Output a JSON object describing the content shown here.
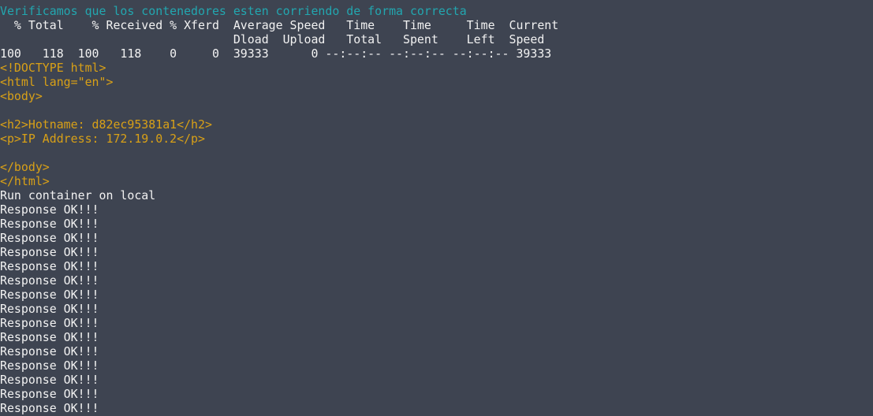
{
  "colors": {
    "background": "#3e4451",
    "cyan": "#22a7b0",
    "white": "#f2f2f2",
    "yellow": "#d8a017"
  },
  "terminal": {
    "lines": [
      {
        "text": "                ",
        "color": "white"
      },
      {
        "text": "Verificamos que los contenedores esten corriendo de forma correcta",
        "color": "cyan"
      },
      {
        "text": "  % Total    % Received % Xferd  Average Speed   Time    Time     Time  Current",
        "color": "white"
      },
      {
        "text": "                                 Dload  Upload   Total   Spent    Left  Speed",
        "color": "white"
      },
      {
        "text": "100   118  100   118    0     0  39333      0 --:--:-- --:--:-- --:--:-- 39333",
        "color": "white"
      },
      {
        "text": "<!DOCTYPE html>",
        "color": "yellow"
      },
      {
        "text": "<html lang=\"en\">",
        "color": "yellow"
      },
      {
        "text": "<body>",
        "color": "yellow"
      },
      {
        "text": "",
        "color": "yellow"
      },
      {
        "text": "<h2>Hotname: d82ec95381a1</h2>",
        "color": "yellow"
      },
      {
        "text": "<p>IP Address: 172.19.0.2</p>",
        "color": "yellow"
      },
      {
        "text": "",
        "color": "yellow"
      },
      {
        "text": "</body>",
        "color": "yellow"
      },
      {
        "text": "</html>",
        "color": "yellow"
      },
      {
        "text": "Run container on local",
        "color": "white"
      },
      {
        "text": "Response OK!!!",
        "color": "white"
      },
      {
        "text": "Response OK!!!",
        "color": "white"
      },
      {
        "text": "Response OK!!!",
        "color": "white"
      },
      {
        "text": "Response OK!!!",
        "color": "white"
      },
      {
        "text": "Response OK!!!",
        "color": "white"
      },
      {
        "text": "Response OK!!!",
        "color": "white"
      },
      {
        "text": "Response OK!!!",
        "color": "white"
      },
      {
        "text": "Response OK!!!",
        "color": "white"
      },
      {
        "text": "Response OK!!!",
        "color": "white"
      },
      {
        "text": "Response OK!!!",
        "color": "white"
      },
      {
        "text": "Response OK!!!",
        "color": "white"
      },
      {
        "text": "Response OK!!!",
        "color": "white"
      },
      {
        "text": "Response OK!!!",
        "color": "white"
      },
      {
        "text": "Response OK!!!",
        "color": "white"
      },
      {
        "text": "Response OK!!!",
        "color": "white"
      }
    ]
  }
}
